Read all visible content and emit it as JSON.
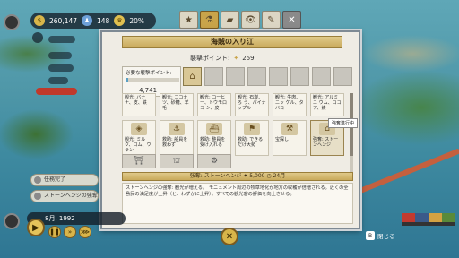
{
  "hud": {
    "money": "260,147",
    "people": "148",
    "approval": "20%"
  },
  "tabs": [
    {
      "icon": "★",
      "name": "tab-star"
    },
    {
      "icon": "⚗",
      "name": "tab-research"
    },
    {
      "icon": "▰",
      "name": "tab-build"
    },
    {
      "icon": "👁",
      "name": "tab-view"
    },
    {
      "icon": "✎",
      "name": "tab-edit"
    }
  ],
  "tab_close": "✕",
  "panel": {
    "title": "海賊の入り江",
    "points_label": "襲撃ポイント:",
    "points_value": "259",
    "required_label": "必要な襲撃ポイント:",
    "required_value": "4,741",
    "required_progress": 0.05
  },
  "cards_row1": [
    "観光: バナナ、皮、鉄",
    "観光: ココナ ツ、砂糖、羊毛",
    "観光: コーヒ ー、トウモロコ シ、皮",
    "観光: 石炭、ろ う、パイナップル",
    "観光: 牛肉、ニッ ケル、タバコ",
    "観光: アルミニ ウム、ココア、鉄"
  ],
  "cards_row2": [
    {
      "text": "観光: ミルク、ゴム、ウラン",
      "icon": "◈"
    },
    {
      "text": "救助: 船員を救わず",
      "icon": "⚓"
    },
    {
      "text": "救助: 整員を受け入れる",
      "icon": "⛴"
    },
    {
      "text": "救助: できるだけ大勢",
      "icon": "⚑"
    },
    {
      "text": "宝探し",
      "icon": "⚒"
    },
    {
      "text": "強奪: ストーンヘンジ",
      "icon": "⌂"
    }
  ],
  "cards_row3": [
    "⛩",
    "⛫",
    "⚙"
  ],
  "tooltip": "強奪進行中",
  "detail": {
    "prefix": "強奪: ストーンヘンジ",
    "cost": "5,000",
    "duration": "24月"
  },
  "description": "ストーンヘンジの強奪: 観光が増える。\nモニュメント周辺の牧草地化が地方の収穫が倍増される。近くの全島民の満足度が上昇（と、わずかに上昇）。すべての観光客の評価を向上させる。",
  "tasks": [
    {
      "label": "任務完了"
    },
    {
      "label": "ストーンヘンジの強奪"
    }
  ],
  "date": "8月, 1992",
  "close_label": "閉じる",
  "close_key": "B"
}
